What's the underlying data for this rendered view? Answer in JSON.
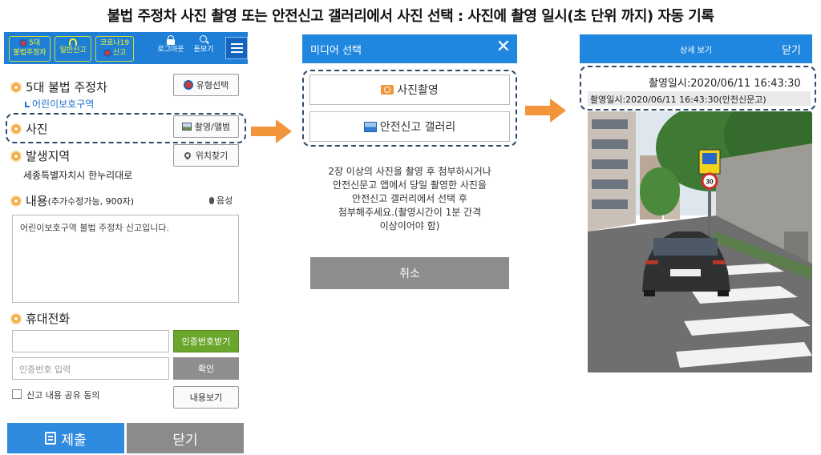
{
  "page_title": "불법 주정차 사진 촬영 또는 안전신고 갤러리에서 사진 선택 : 사진에 촬영 일시(초 단위 까지) 자동 기록",
  "panel1": {
    "header": {
      "btn1_line1": "5대",
      "btn1_line2": "불법주정차",
      "btn2": "일반신고",
      "btn3_line1": "코로나19",
      "btn3_line2": "신고",
      "logout": "로그아웃",
      "zoom": "돋보기"
    },
    "type_section": {
      "label": "5대 불법 주정차",
      "sub": "어린이보호구역",
      "button": "유형선택"
    },
    "photo_section": {
      "label": "사진",
      "button": "촬영/앨범"
    },
    "location_section": {
      "label": "발생지역",
      "value": "세종특별자치시 한누리대로",
      "button": "위치찾기"
    },
    "content_section": {
      "label": "내용",
      "hint": "(추가수정가능, 900자)",
      "voice": "음성",
      "text": "어린이보호구역 불법 주정차 신고입니다."
    },
    "phone_section": {
      "label": "휴대전화",
      "phone_value": "",
      "auth_button": "인증번호받기",
      "code_placeholder": "인증번호 입력",
      "confirm_button": "확인",
      "share_label": "신고 내용 공유 동의",
      "view_button": "내용보기"
    },
    "submit": "제출",
    "close": "닫기"
  },
  "panel2": {
    "title": "미디어 선택",
    "close_glyph": "✕",
    "option_camera": "사진촬영",
    "option_gallery": "안전신고 갤러리",
    "message_lines": [
      "2장 이상의 사진을 촬영 후 첨부하시거나",
      "안전신문고 앱에서 당일 촬영한 사진을",
      "안전신고 갤러리에서 선택 후",
      "첨부해주세요.(촬영시간이 1분 간격",
      "이상이어야 함)"
    ],
    "cancel": "취소"
  },
  "panel3": {
    "title": "상세 보기",
    "close": "닫기",
    "timestamp_1": "촬영일시:2020/06/11 16:43:30",
    "timestamp_2": "촬영일시:2020/06/11 16:43:30(안전신문고)",
    "sign_number": "30"
  },
  "colors": {
    "header_blue": "#1f7fd6",
    "accent_orange": "#f2943a",
    "auth_green": "#6aa62b",
    "dash_border": "#2e4a6e"
  }
}
